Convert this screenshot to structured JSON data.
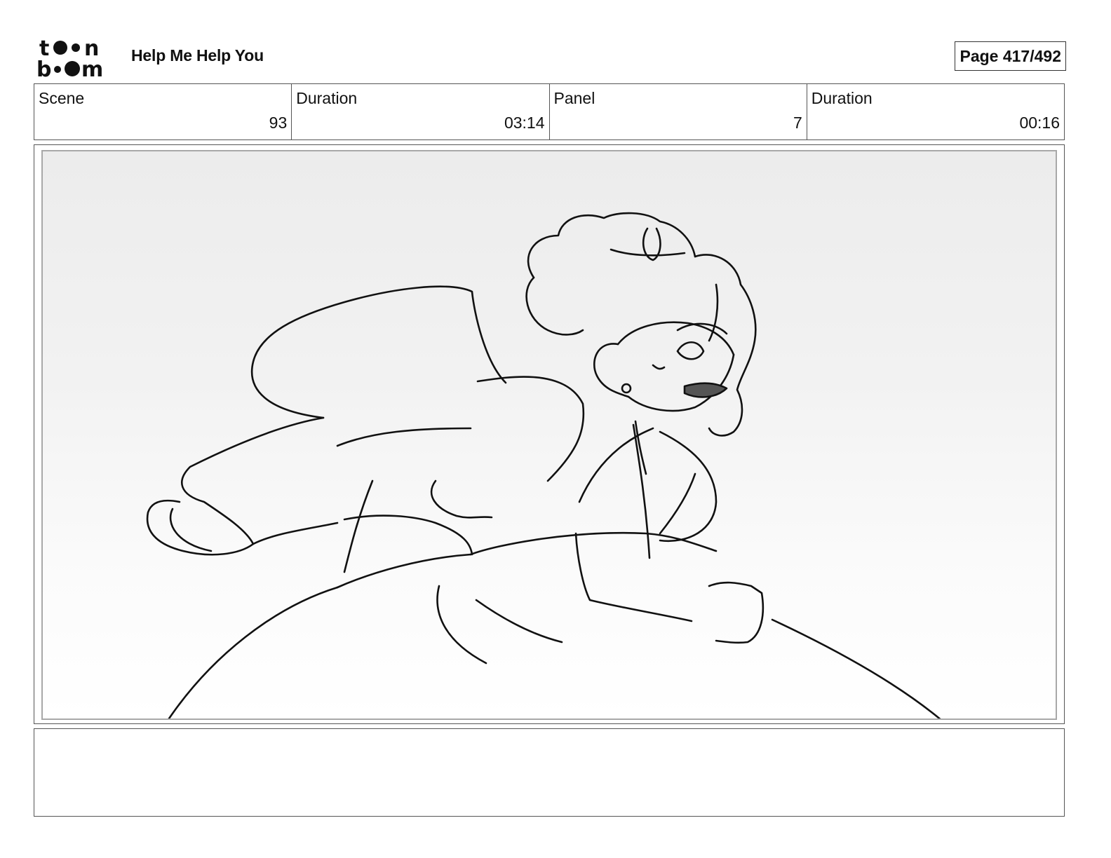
{
  "logo": {
    "line1": "toon",
    "line2": "boom",
    "icon": "toon-boom-logo"
  },
  "project": {
    "title": "Help Me Help You"
  },
  "page": {
    "label": "Page 417/492"
  },
  "info": {
    "scene_label": "Scene",
    "scene_value": "93",
    "scene_duration_label": "Duration",
    "scene_duration_value": "03:14",
    "panel_label": "Panel",
    "panel_value": "7",
    "panel_duration_label": "Duration",
    "panel_duration_value": "00:16"
  },
  "panel": {
    "drawing": "storyboard-sketch-woman-flowing-hair-ballgown"
  },
  "notes": {
    "text": ""
  }
}
